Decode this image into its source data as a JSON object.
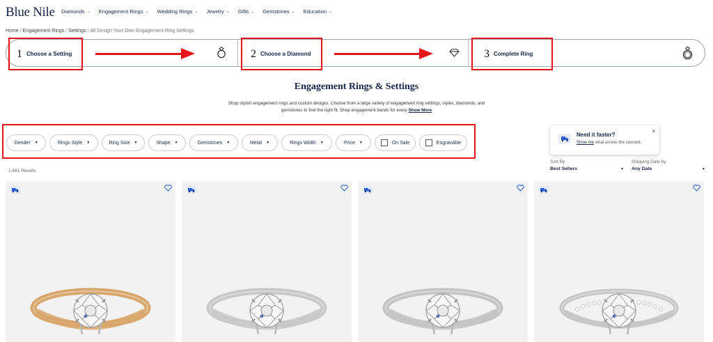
{
  "brand": {
    "logo": "Blue Nile"
  },
  "nav": {
    "items": [
      {
        "label": "Diamonds",
        "has_chevron": true
      },
      {
        "label": "Engagement Rings",
        "has_chevron": true
      },
      {
        "label": "Wedding Rings",
        "has_chevron": true
      },
      {
        "label": "Jewelry",
        "has_chevron": true
      },
      {
        "label": "Gifts",
        "has_chevron": true
      },
      {
        "label": "Gemstones",
        "has_chevron": true
      },
      {
        "label": "Education",
        "has_chevron": true
      }
    ]
  },
  "breadcrumb": {
    "items": [
      "Home",
      "Engagement Rings",
      "Settings",
      "All Design Your Own Engagement Ring Settings"
    ]
  },
  "stepper": {
    "steps": [
      {
        "num": "1",
        "label": "Choose a Setting",
        "icon": "ring-icon"
      },
      {
        "num": "2",
        "label": "Choose a Diamond",
        "icon": "diamond-icon"
      },
      {
        "num": "3",
        "label": "Complete Ring",
        "icon": "complete-ring-icon"
      }
    ]
  },
  "page": {
    "title": "Engagement Rings & Settings",
    "description": "Shop stylish engagement rings and custom designs. Choose from a large variety of engagement ring settings, styles, diamonds, and gemstones to find the right fit. Shop engagement bands for every",
    "show_more": "Show More"
  },
  "filters": {
    "dropdowns": [
      "Gender",
      "Rings Style",
      "Ring Size",
      "Shape",
      "Gemstones",
      "Metal",
      "Rings Width",
      "Price"
    ],
    "checkboxes": [
      {
        "label": "On Sale",
        "checked": false
      },
      {
        "label": "Engravable",
        "checked": false
      }
    ]
  },
  "popup": {
    "title": "Need it faster?",
    "link_text": "Show me",
    "subtitle_rest": "what arrives the soonest.",
    "close": "×"
  },
  "sort": {
    "label": "Sort By",
    "value": "Best Sellers"
  },
  "shipping": {
    "label": "Shipping Date by",
    "value": "Any Date"
  },
  "results": {
    "count_text": "1,461 Results"
  },
  "products": [
    {
      "metal": "yellow-gold",
      "band_color": "#d8a66a",
      "style": "solitaire"
    },
    {
      "metal": "white-gold",
      "band_color": "#c8c8c8",
      "style": "solitaire"
    },
    {
      "metal": "platinum",
      "band_color": "#c4c4c4",
      "style": "solitaire"
    },
    {
      "metal": "white-gold",
      "band_color": "#c6c6c6",
      "style": "twisted-pave"
    }
  ],
  "colors": {
    "annotation_red": "#e8141b",
    "brand_navy": "#17244a",
    "card_bg": "#f2f2f2",
    "badge_blue": "#2a5bd7"
  }
}
